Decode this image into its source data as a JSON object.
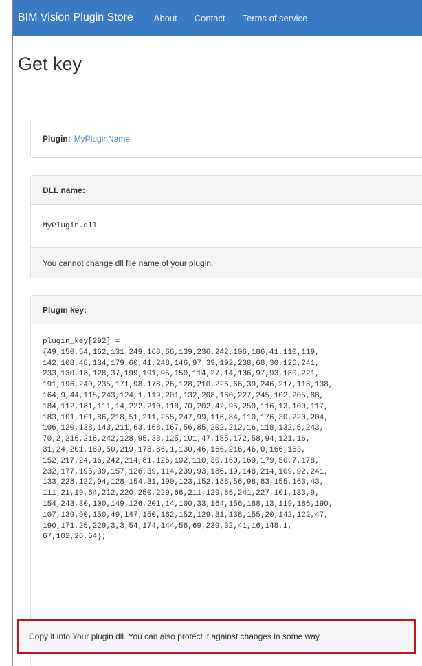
{
  "navbar": {
    "brand": "BIM Vision Plugin Store",
    "links": [
      "About",
      "Contact",
      "Terms of service"
    ]
  },
  "page_title": "Get key",
  "plugin_panel": {
    "label": "Plugin:",
    "value": "MyPluginName"
  },
  "dll_panel": {
    "heading": "DLL name:",
    "value": "MyPlugin.dll",
    "footer": "You cannot change dll file name of your plugin."
  },
  "key_panel": {
    "heading": "Plugin key:",
    "lines": [
      "plugin_key[292] =",
      "{49,150,54,162,131,249,168,66,139,236,242,106,186,41,110,119,",
      "142,108,48,134,179,60,41,248,146,97,39,192,238,68,30,126,241,",
      "233,130,18,128,37,199,191,95,150,114,27,14,136,97,93,180,221,",
      "191,196,240,235,171,98,178,26,128,210,226,66,39,246,217,118,138,",
      "164,9,44,115,243,124,1,119,201,132,208,160,227,245,102,205,88,",
      "184,112,181,111,14,222,210,118,70,202,42,95,250,116,13,100,117,",
      "183,101,101,86,218,51,211,255,247,99,116,84,110,176,30,220,204,",
      "106,120,138,143,211,63,168,167,56,85,202,212,16,118,132,5,243,",
      "70,2,216,216,242,128,95,33,125,101,47,185,172,58,94,121,16,",
      "31,24,201,189,50,219,178,86,1,130,46,166,216,46,0,166,163,",
      "152,217,24,16,242,214,81,126,192,110,30,160,169,179,50,7,178,",
      "232,177,195,39,157,126,39,114,239,93,186,19,148,214,109,92,241,",
      "133,228,122,94,128,154,31,190,123,152,188,56,98,83,155,163,43,",
      "111,21,19,64,212,220,250,229,66,211,129,86,241,227,101,133,9,",
      "154,243,30,100,149,126,201,14,100,33,164,156,188,13,119,186,190,",
      "107,139,90,150,49,147,150,162,152,129,31,138,155,20,142,122,47,",
      "190,171,25,229,3,3,54,174,144,56,69,239,32,41,16,148,1,",
      "67,102,26,64};"
    ],
    "footer": "Copy it info Your plugin dll. You can also protect it against changes in some way."
  },
  "colors": {
    "navbar": "#3a7ac4",
    "link": "#428bca",
    "highlight_border": "#c4141c"
  }
}
